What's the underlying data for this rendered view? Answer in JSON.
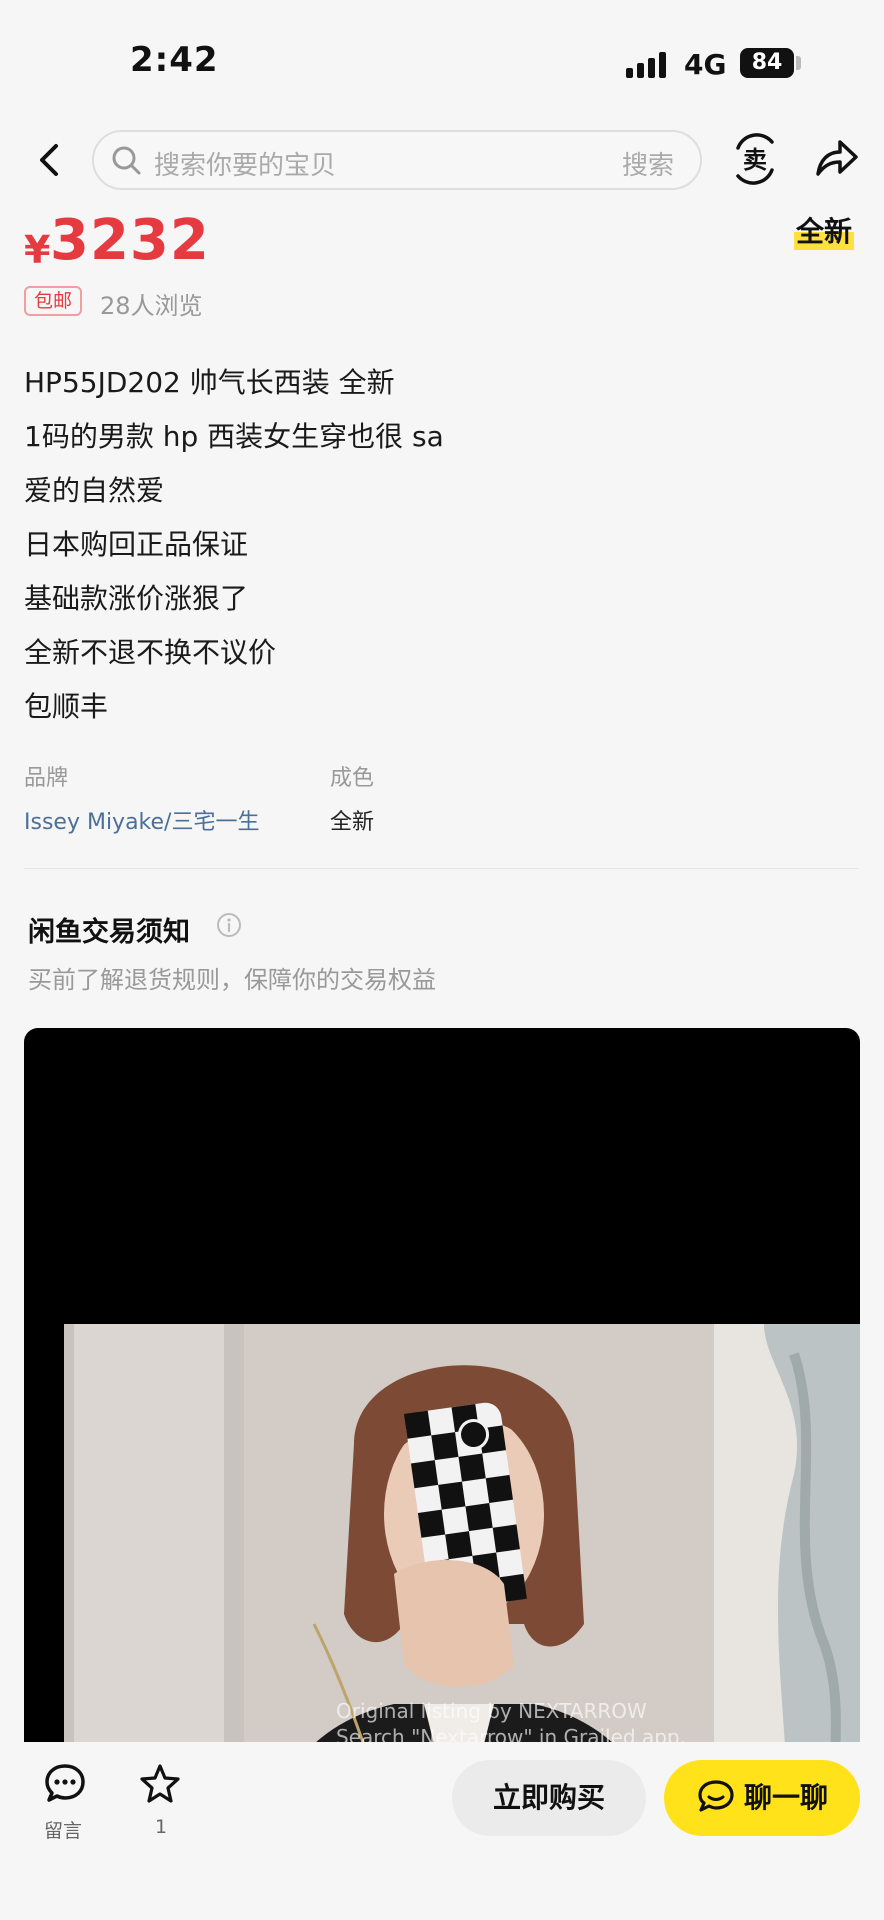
{
  "status_bar": {
    "time": "2:42",
    "network": "4G",
    "battery": "84"
  },
  "header": {
    "search_placeholder": "搜索你要的宝贝",
    "search_button": "搜索",
    "sell_icon_char": "卖",
    "icons": [
      "back-icon",
      "search-icon",
      "sell-icon",
      "share-icon"
    ]
  },
  "listing": {
    "price_symbol": "¥",
    "price": "3232",
    "condition_tag": "全新",
    "shipping_badge": "包邮",
    "views": "28人浏览",
    "description": [
      "HP55JD202 帅气长西装 全新",
      "1码的男款 hp 西装女生穿也很 sa",
      "爱的自然爱",
      "日本购回正品保证",
      "基础款涨价涨狠了",
      "全新不退不换不议价",
      "包顺丰"
    ]
  },
  "attributes": {
    "brand_label": "品牌",
    "brand_value": "Issey Miyake/三宅一生",
    "condition_label": "成色",
    "condition_value": "全新"
  },
  "notice": {
    "title": "闲鱼交易须知",
    "subtitle": "买前了解退货规则，保障你的交易权益"
  },
  "watermark": {
    "line1": "Original listing by NEXTARROW",
    "line2": "Search \"Nextarrow\" in Grailed app."
  },
  "bottom_bar": {
    "comment_label": "留言",
    "favorite_count": "1",
    "buy_label": "立即购买",
    "chat_label": "聊一聊"
  },
  "colors": {
    "price": "#e53a3f",
    "accent_yellow": "#ffe219",
    "brand_link": "#4c6f98"
  }
}
